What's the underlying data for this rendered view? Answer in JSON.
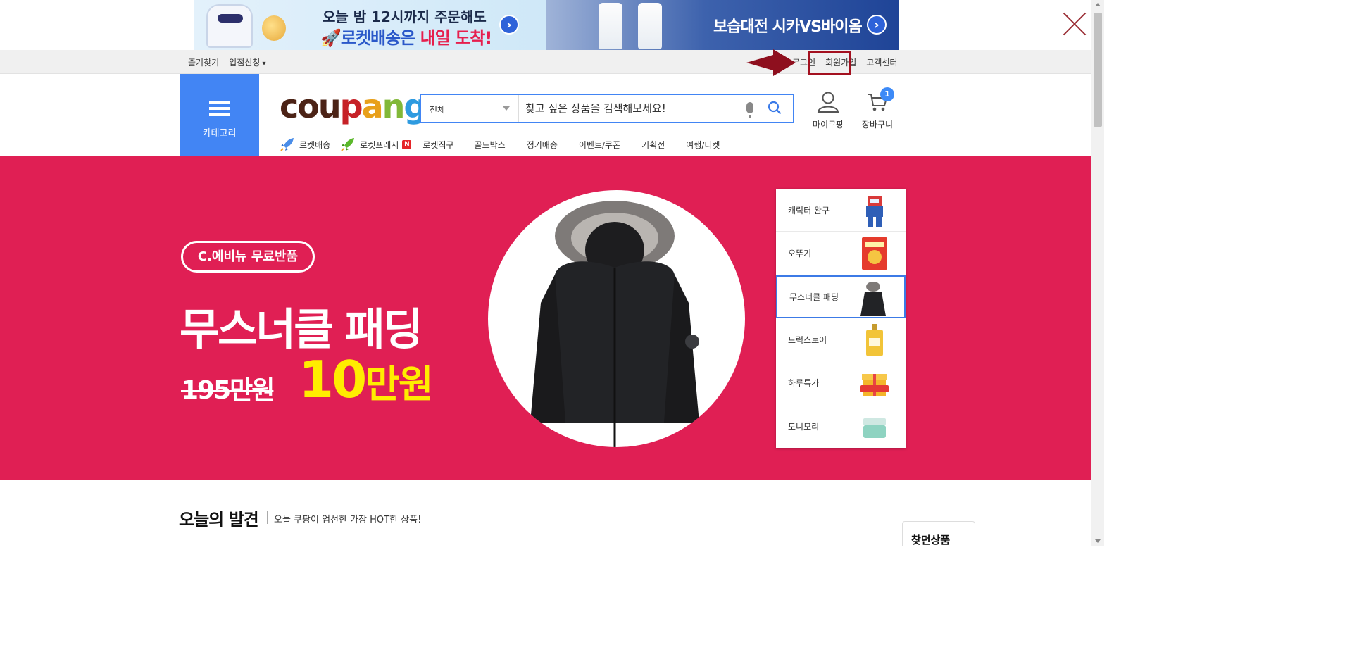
{
  "ad_banner": {
    "left_line1": "오늘 밤 12시까지 주문해도",
    "left_line2_prefix": "로켓배송은 ",
    "left_line2_highlight": "내일 도착!",
    "right_text": "보습대전 시카VS바이옴"
  },
  "util_bar": {
    "favorites": "즐겨찾기",
    "seller_apply": "입점신청",
    "login": "로그인",
    "signup": "회원가입",
    "customer_center": "고객센터"
  },
  "header": {
    "category_label": "카테고리",
    "logo_parts": [
      "cou",
      "p",
      "a",
      "n",
      "g"
    ],
    "search_category": "전체",
    "search_placeholder": "찾고 싶은 상품을 검색해보세요!",
    "my_coupang": "마이쿠팡",
    "cart": "장바구니",
    "cart_count": "1"
  },
  "gnb": {
    "items": [
      "로켓배송",
      "로켓프레시",
      "로켓직구",
      "골드박스",
      "정기배송",
      "이벤트/쿠폰",
      "기획전",
      "여행/티켓"
    ],
    "new_badge": "N"
  },
  "hero": {
    "badge": "C.에비뉴 무료반품",
    "title": "무스너클 패딩",
    "old_price": "195만원",
    "new_price_number": "10",
    "new_price_unit": "만원",
    "background_color": "#e01f54",
    "side_items": [
      "캐릭터 완구",
      "오뚜기",
      "무스너클 패딩",
      "드럭스토어",
      "하루특가",
      "토니모리"
    ],
    "active_side_index": 2
  },
  "today": {
    "title": "오늘의 발견",
    "subtitle": "오늘 쿠팡이 엄선한 가장 HOT한 상품!",
    "recent_label": "찾던상품"
  },
  "icons": {
    "close": "close-icon",
    "menu": "hamburger-icon",
    "search": "search-icon",
    "mic": "mic-icon",
    "user": "user-icon",
    "cart": "cart-icon",
    "rocket": "rocket-icon"
  }
}
